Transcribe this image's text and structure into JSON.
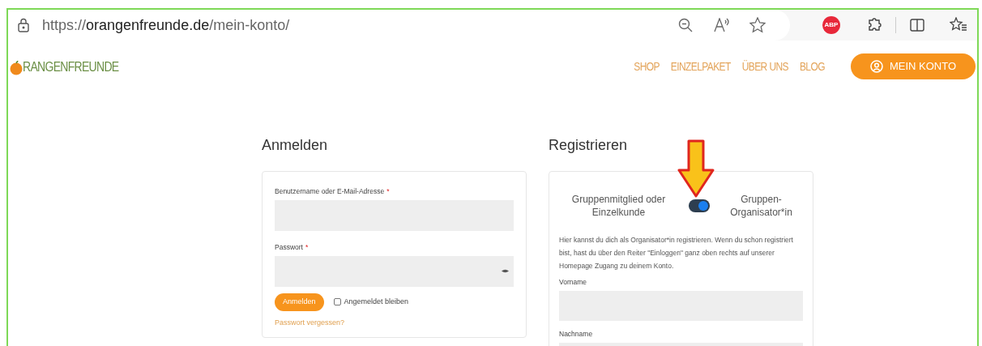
{
  "browser": {
    "url": "https://**orangenfreunde.de**/mein-konto/",
    "adblock_badge": "ABP"
  },
  "site": {
    "logo_text": "RANGENFREUNDE",
    "nav": [
      "SHOP",
      "EINZELPAKET",
      "ÜBER UNS",
      "BLOG"
    ],
    "account_button": "MEIN KONTO"
  },
  "login": {
    "heading": "Anmelden",
    "fields": [
      {
        "label": "Benutzername oder E-Mail-Adresse",
        "required": true,
        "kind": "text"
      },
      {
        "label": "Passwort",
        "required": true,
        "kind": "password"
      }
    ],
    "required_mark": "*",
    "submit": "Anmelden",
    "remember": {
      "label": "Angemeldet bleiben",
      "checked": false
    },
    "forgot_link": "Passwort vergessen?"
  },
  "register": {
    "heading": "Registrieren",
    "toggle_left": "Gruppenmitglied oder Einzelkunde",
    "toggle_right": "Gruppen-Organisator*in",
    "toggle_on": true,
    "intro": "Hier kannst du dich als Organisator*in registrieren. Wenn du schon registriert bist, hast du über den Reiter \"Einloggen\" ganz oben rechts auf unserer Homepage Zugang zu deinem Konto.",
    "fields": [
      {
        "label": "Vorname"
      },
      {
        "label": "Nachname"
      }
    ]
  }
}
